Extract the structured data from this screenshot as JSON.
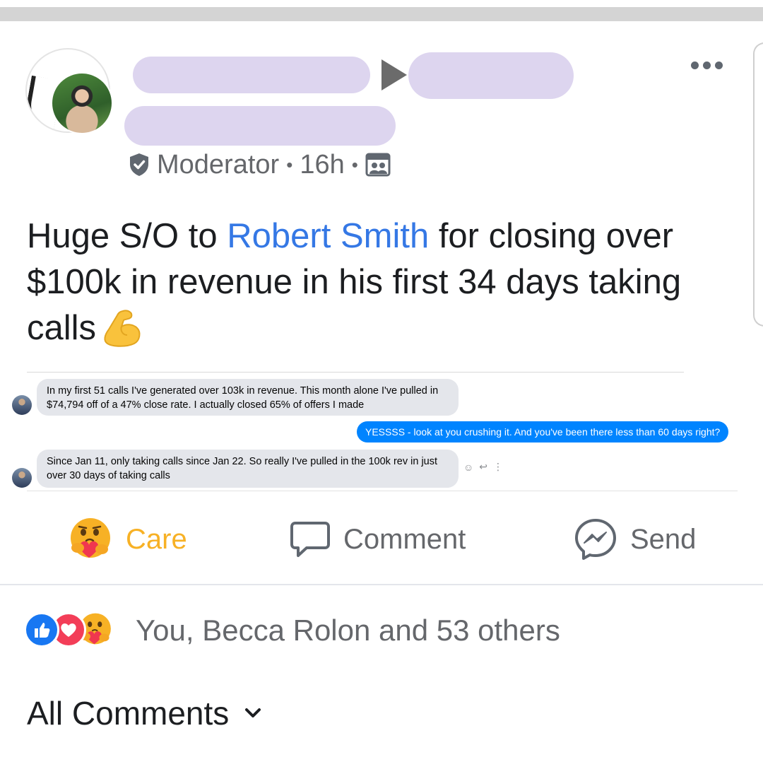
{
  "post": {
    "role": "Moderator",
    "separator": "•",
    "time": "16h",
    "text_before": "Huge S/O to ",
    "mention": "Robert Smith",
    "text_after": " for closing over $100k in revenue in his first 34 days taking calls"
  },
  "chat_screenshot": {
    "messages": [
      {
        "from": "them",
        "text": "In my first 51 calls I've generated over 103k in revenue. This month alone I've pulled in $74,794 off of a 47% close rate. I actually closed 65% of offers I made"
      },
      {
        "from": "me",
        "text": "YESSSS - look at you crushing it. And you've been there less than 60 days right?"
      },
      {
        "from": "them",
        "text": "Since Jan 11, only taking calls since Jan 22. So really I've pulled in the 100k rev in just over 30 days of taking calls"
      }
    ]
  },
  "actions": {
    "care": "Care",
    "comment": "Comment",
    "send": "Send"
  },
  "reactions": {
    "summary": "You, Becca Rolon and 53 others"
  },
  "comments": {
    "filter_label": "All Comments"
  },
  "colors": {
    "mention": "#3578e5",
    "care": "#f7b125",
    "messenger_blue": "#0084ff",
    "secondary_text": "#65676b"
  }
}
